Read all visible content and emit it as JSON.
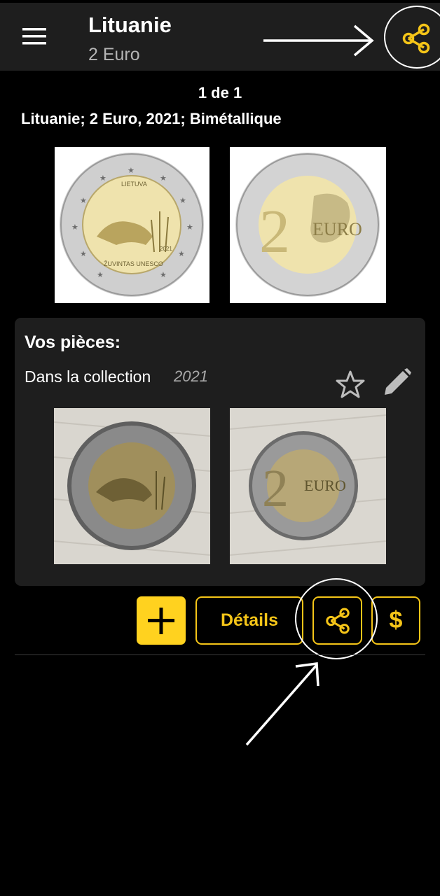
{
  "header": {
    "title": "Lituanie",
    "subtitle": "2 Euro",
    "menu_icon": "hamburger-menu-icon",
    "share_icon": "share-icon"
  },
  "counter": "1 de 1",
  "coin": {
    "description": "Lituanie; 2 Euro, 2021; Bimétallique",
    "obverse_legend_top": "LIETUVA",
    "obverse_legend_bottom": "ŽUVINTAS UNESCO",
    "obverse_year": "2021",
    "reverse_denomination": "2",
    "reverse_word": "EURO"
  },
  "collection": {
    "title": "Vos pièces:",
    "label": "Dans la collection",
    "year": "2021",
    "favorite_icon": "star-icon",
    "edit_icon": "pencil-icon"
  },
  "actions": {
    "add_icon": "plus-icon",
    "details_label": "Détails",
    "share_icon": "share-icon",
    "price_label": "$"
  },
  "colors": {
    "accent": "#f5c518",
    "bar": "#1e1e1e",
    "background": "#000000"
  }
}
